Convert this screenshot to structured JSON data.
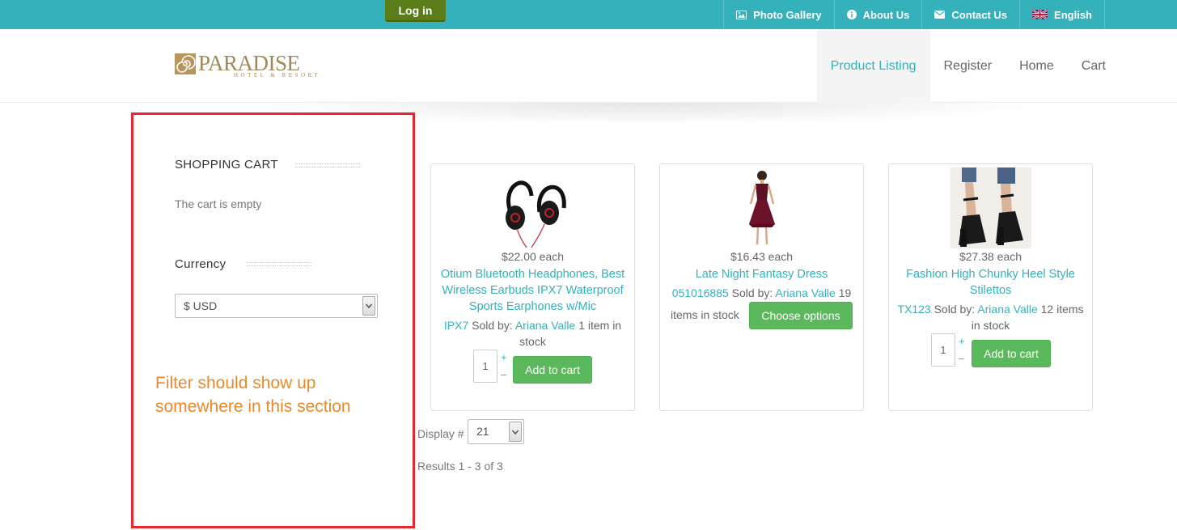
{
  "topbar": {
    "login_label": "Log in",
    "links": [
      {
        "label": "Photo Gallery",
        "icon": "image-icon"
      },
      {
        "label": "About Us",
        "icon": "info-icon"
      },
      {
        "label": "Contact Us",
        "icon": "envelope-icon"
      },
      {
        "label": "English",
        "icon": "uk-flag-icon"
      }
    ]
  },
  "header": {
    "logo_main": "PARADISE",
    "logo_sub": "HOTEL & RESORT",
    "nav": [
      "Product Listing",
      "Register",
      "Home",
      "Cart"
    ],
    "active_nav": "Product Listing"
  },
  "sidebar": {
    "cart_heading": "SHOPPING CART",
    "cart_empty": "The cart is empty",
    "currency_heading": "Currency",
    "currency_value": "$ USD"
  },
  "annotation": {
    "text": "Filter should show up somewhere in this section",
    "color": "#e8262f"
  },
  "products": [
    {
      "price": "$22.00 each",
      "name": "Otium Bluetooth Headphones, Best Wireless Earbuds IPX7 Waterproof Sports Earphones w/Mic",
      "sku": "IPX7",
      "sold_by_label": "Sold by:",
      "seller": "Ariana Valle",
      "stock": "1 item in stock",
      "qty": "1",
      "button": "Add to cart"
    },
    {
      "price": "$16.43 each",
      "name": "Late Night Fantasy Dress",
      "sku": "051016885",
      "sold_by_label": "Sold by:",
      "seller": "Ariana Valle",
      "stock_a": "19",
      "stock_b": "items in stock",
      "button": "Choose options"
    },
    {
      "price": "$27.38 each",
      "name": "Fashion High Chunky Heel Style Stilettos",
      "sku": "TX123",
      "sold_by_label": "Sold by:",
      "seller": "Ariana Valle",
      "stock_a": "12 items",
      "stock_b": "in stock",
      "qty": "1",
      "button": "Add to cart"
    }
  ],
  "pagination": {
    "display_label": "Display #",
    "display_value": "21",
    "results": "Results 1 - 3 of 3"
  },
  "colors": {
    "topbar": "#35b1bb",
    "accent": "#35b1bb",
    "login": "#5a7d1a",
    "button": "#5cb85c",
    "annotation_text": "#e88a2c"
  }
}
